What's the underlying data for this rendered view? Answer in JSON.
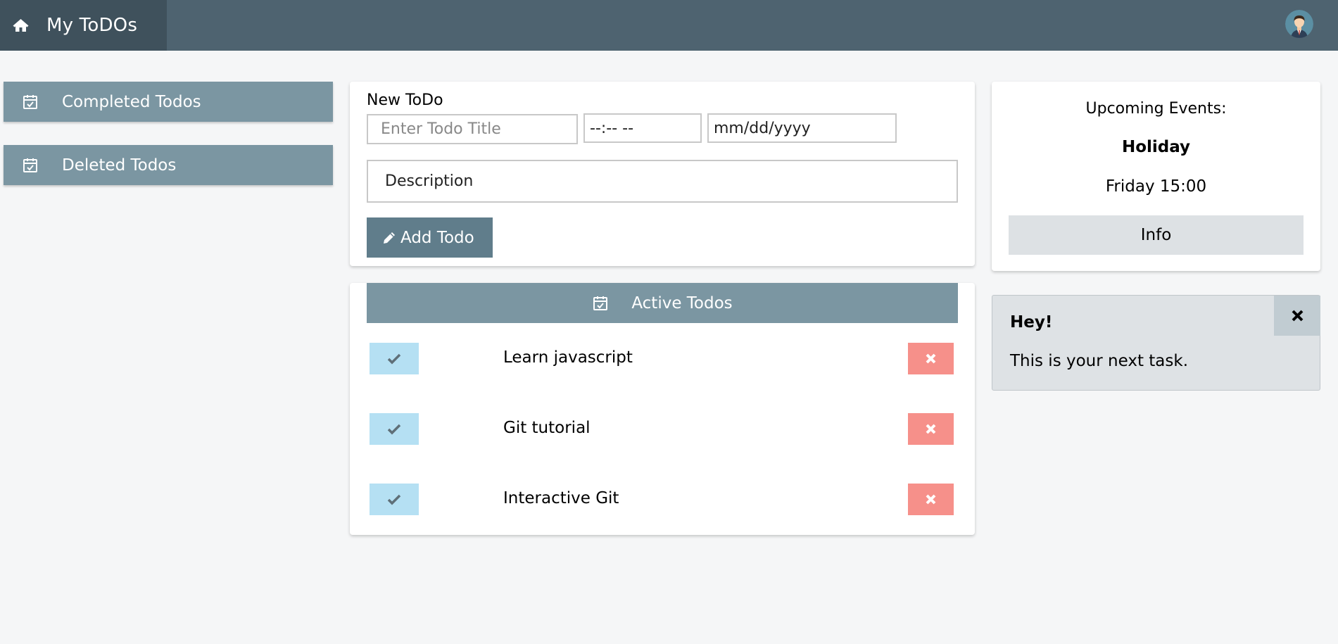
{
  "topbar": {
    "app_title": "My ToDOs",
    "home_icon": "home-icon",
    "avatar_icon": "user-avatar",
    "colors": {
      "bar": "#4e6370",
      "home": "#3f515c"
    }
  },
  "sidebar": {
    "items": [
      {
        "label": "Completed Todos",
        "icon": "calendar-check-icon"
      },
      {
        "label": "Deleted Todos",
        "icon": "calendar-check-icon"
      }
    ],
    "color": "#7b96a2"
  },
  "new_todo": {
    "heading": "New ToDo",
    "title_placeholder": "Enter Todo Title",
    "time_placeholder": "--:-- --",
    "date_placeholder": "mm/dd/yyyy",
    "description_placeholder": "Description",
    "add_label": "Add Todo",
    "add_icon": "pencil-icon",
    "add_color": "#607d8b"
  },
  "active": {
    "header": "Active Todos",
    "header_icon": "calendar-check-icon",
    "items": [
      {
        "text": "Learn javascript"
      },
      {
        "text": "Git tutorial"
      },
      {
        "text": "Interactive Git"
      }
    ],
    "check_color": "#b5e0f3",
    "delete_color": "#f6908a"
  },
  "events": {
    "heading": "Upcoming Events:",
    "name": "Holiday",
    "time": "Friday 15:00",
    "info_label": "Info"
  },
  "alert": {
    "title": "Hey!",
    "body": "This is your next task.",
    "close_icon": "close-icon"
  }
}
